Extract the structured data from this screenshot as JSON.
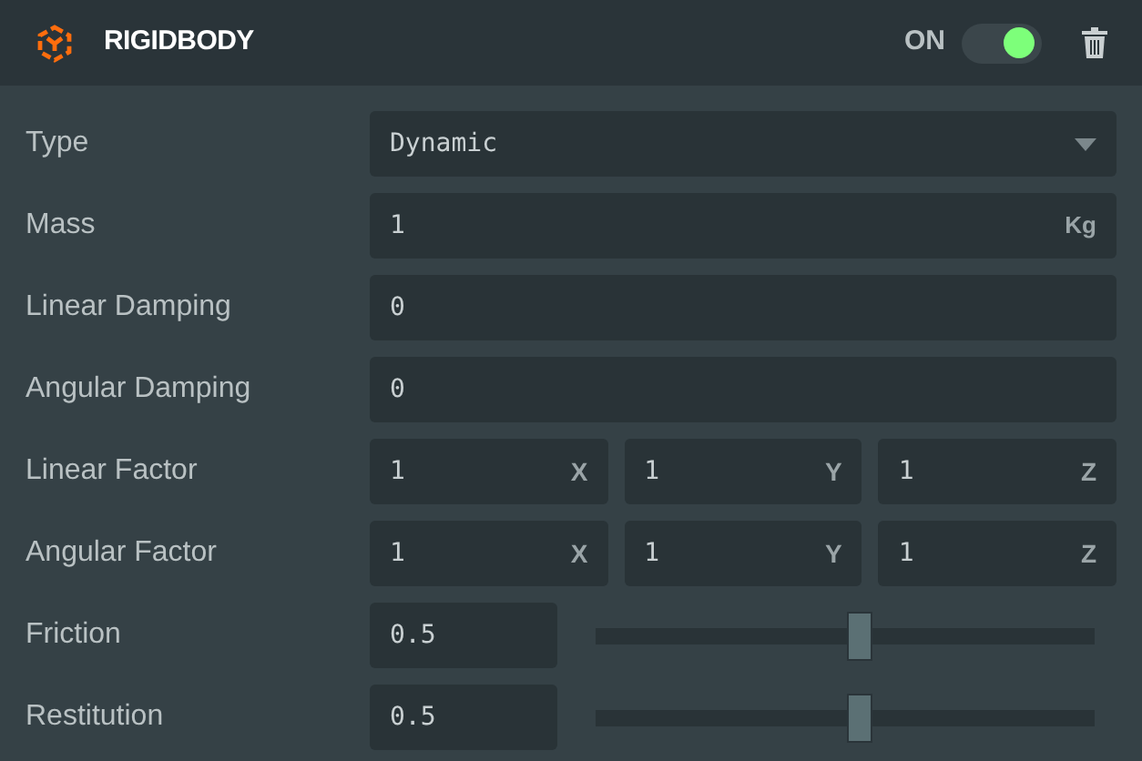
{
  "header": {
    "title": "RIGIDBODY",
    "toggle_label": "ON",
    "on": true
  },
  "rows": [
    {
      "kind": "select",
      "label": "Type",
      "value": "Dynamic"
    },
    {
      "kind": "unit",
      "label": "Mass",
      "value": "1",
      "unit": "Kg"
    },
    {
      "kind": "number",
      "label": "Linear Damping",
      "value": "0"
    },
    {
      "kind": "number",
      "label": "Angular Damping",
      "value": "0"
    },
    {
      "kind": "vector",
      "label": "Linear Factor",
      "fields": [
        {
          "value": "1",
          "axis": "X"
        },
        {
          "value": "1",
          "axis": "Y"
        },
        {
          "value": "1",
          "axis": "Z"
        }
      ]
    },
    {
      "kind": "vector",
      "label": "Angular Factor",
      "fields": [
        {
          "value": "1",
          "axis": "X"
        },
        {
          "value": "1",
          "axis": "Y"
        },
        {
          "value": "1",
          "axis": "Z"
        }
      ]
    },
    {
      "kind": "slider",
      "label": "Friction",
      "value": "0.5",
      "level": 0.53
    },
    {
      "kind": "slider",
      "label": "Restitution",
      "value": "0.5",
      "level": 0.53
    }
  ]
}
